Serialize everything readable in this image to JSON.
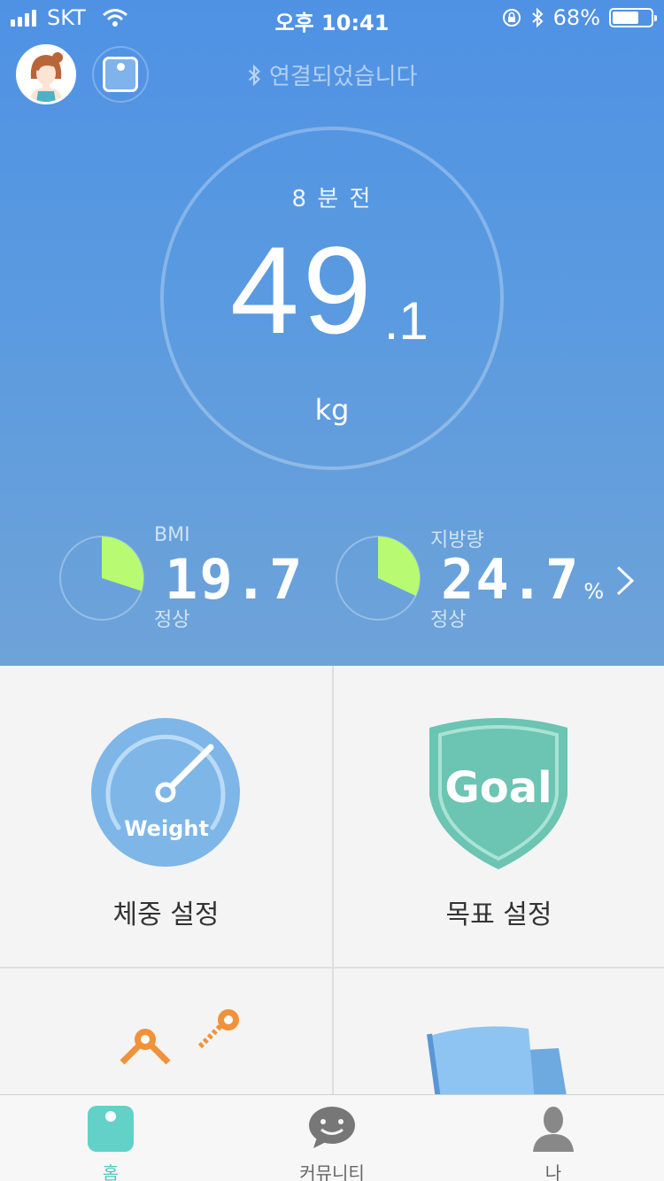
{
  "status_bar": {
    "carrier": "SKT",
    "time": "오후 10:41",
    "battery": "68%",
    "battery_level": 0.68
  },
  "header": {
    "connection_text": "연결되었습니다",
    "icons": [
      "profile-avatar",
      "scale-icon",
      "bluetooth-icon"
    ]
  },
  "measurement": {
    "time_ago": "8 분 전",
    "weight_int": "49",
    "weight_dec": ".1",
    "unit": "kg"
  },
  "metrics": [
    {
      "label": "BMI",
      "value": "19.7",
      "unit": "",
      "status": "정상",
      "ring_fraction": 0.3
    },
    {
      "label": "지방량",
      "value": "24.7",
      "unit": "%",
      "status": "정상",
      "ring_fraction": 0.32
    }
  ],
  "menu": [
    {
      "label": "체중 설정",
      "icon": "weight-gauge-icon",
      "icon_text": "Weight"
    },
    {
      "label": "목표 설정",
      "icon": "goal-shield-icon",
      "icon_text": "Goal"
    }
  ],
  "tabs": [
    {
      "label": "홈",
      "icon": "home-scale-icon",
      "active": true
    },
    {
      "label": "커뮤니티",
      "icon": "chat-icon",
      "active": false
    },
    {
      "label": "나",
      "icon": "person-icon",
      "active": false
    }
  ],
  "colors": {
    "hero_top": "#4f92e4",
    "hero_bottom": "#6ea3d8",
    "ring_fill": "#b8fb72",
    "accent": "#4fc8c0",
    "weight_icon": "#7eb6e8",
    "goal_icon": "#6cc4b2",
    "orange": "#f0923a"
  }
}
